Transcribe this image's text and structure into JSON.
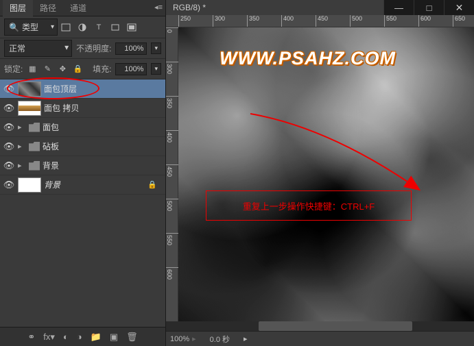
{
  "titlebar": {
    "title": "RGB/8) *"
  },
  "panel": {
    "tabs": [
      "图层",
      "路径",
      "通道"
    ],
    "filter_label": "类型",
    "blend_mode": "正常",
    "opacity_label": "不透明度:",
    "opacity_value": "100%",
    "lock_label": "锁定:",
    "fill_label": "填充:",
    "fill_value": "100%"
  },
  "layers": [
    {
      "name": "面包顶层",
      "type": "bitmap",
      "selected": true,
      "thumb": "marble"
    },
    {
      "name": "面包 拷贝",
      "type": "bitmap",
      "selected": false,
      "thumb": "bread"
    },
    {
      "name": "面包",
      "type": "folder",
      "selected": false
    },
    {
      "name": "砧板",
      "type": "folder",
      "selected": false
    },
    {
      "name": "背景",
      "type": "folder",
      "selected": false
    },
    {
      "name": "背景",
      "type": "bitmap",
      "selected": false,
      "locked": true,
      "thumb": "white",
      "italic": true
    }
  ],
  "canvas": {
    "watermark": "WWW.PSAHZ.COM",
    "annotation": "重复上一步操作快捷键：CTRL+F"
  },
  "status": {
    "zoom": "100%",
    "time": "0.0 秒"
  },
  "ruler_h": [
    "250",
    "300",
    "350",
    "400",
    "450",
    "500",
    "550",
    "600",
    "650"
  ],
  "ruler_v": [
    "0",
    "300",
    "350",
    "400",
    "450",
    "500",
    "550",
    "600"
  ]
}
